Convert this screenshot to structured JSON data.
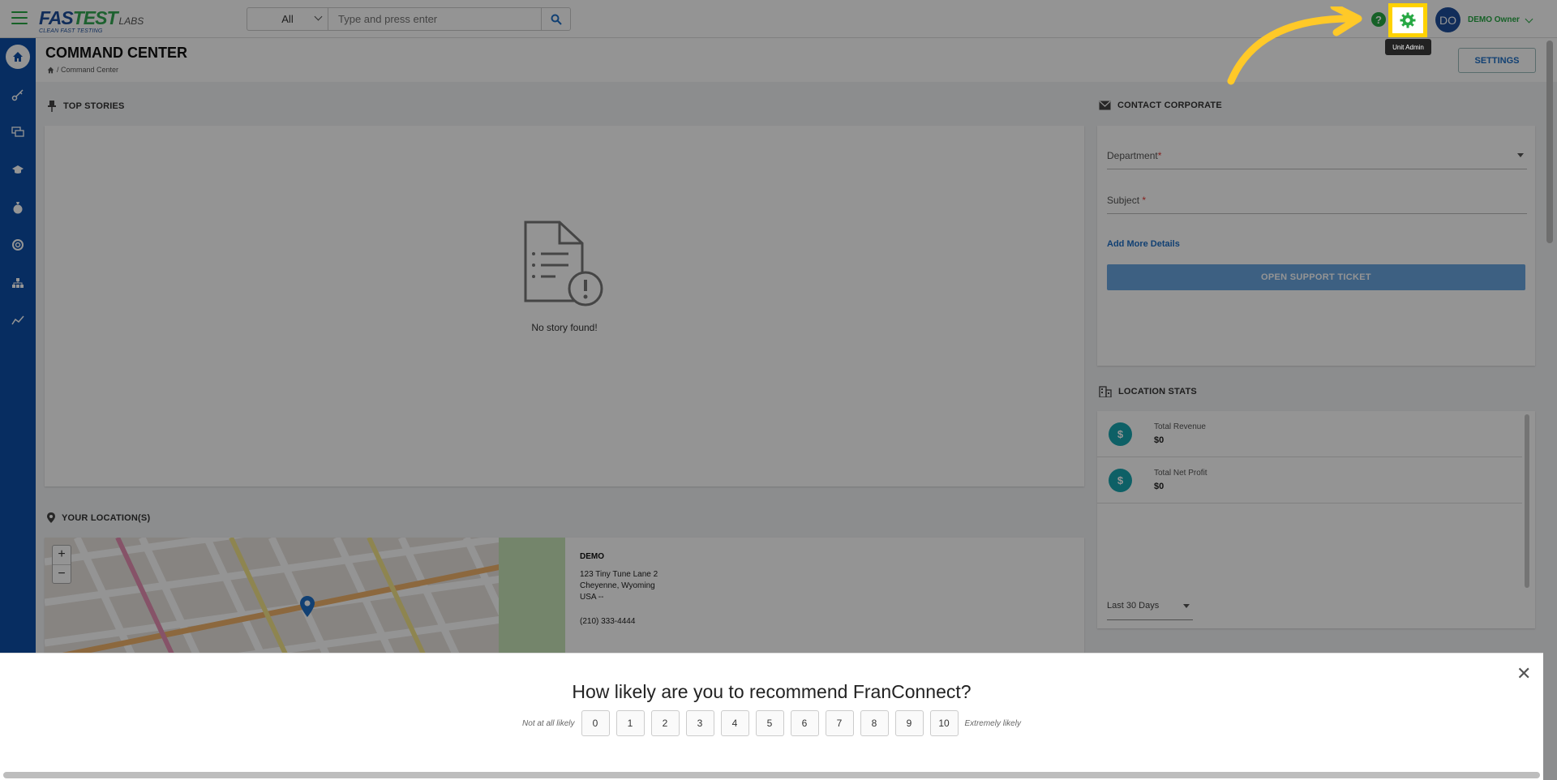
{
  "app": {
    "brand_main": "FASTEST",
    "brand_sub": "LABS",
    "tagline": "CLEAN FAST TESTING"
  },
  "search": {
    "scope": "All",
    "placeholder": "Type and press enter"
  },
  "header": {
    "tooltip": "Unit Admin",
    "avatar_initials": "DO",
    "user_name": "DEMO Owner"
  },
  "page": {
    "title": "COMMAND CENTER",
    "breadcrumb": "/ Command Center",
    "settings_label": "SETTINGS"
  },
  "nav": {
    "items": [
      "home",
      "key",
      "chat",
      "graduation",
      "money-bag",
      "support",
      "org-chart",
      "analytics"
    ]
  },
  "top_stories": {
    "label": "TOP STORIES",
    "empty": "No story found!"
  },
  "contact": {
    "label": "CONTACT CORPORATE",
    "department": "Department",
    "subject": "Subject",
    "required": "*",
    "add_details": "Add More Details",
    "open_ticket": "OPEN SUPPORT TICKET"
  },
  "stats": {
    "label": "LOCATION STATS",
    "rows": [
      {
        "label": "Total Revenue",
        "value": "$0"
      },
      {
        "label": "Total Net Profit",
        "value": "$0"
      }
    ],
    "period": "Last 30 Days"
  },
  "locations": {
    "label": "YOUR LOCATION(S)",
    "name": "DEMO",
    "line1": "123 Tiny Tune Lane 2",
    "line2": "Cheyenne, Wyoming",
    "line3": "USA --",
    "phone": "(210) 333-4444",
    "zoom_in": "+",
    "zoom_out": "−"
  },
  "survey": {
    "question": "How likely are you to recommend FranConnect?",
    "low_label": "Not at all likely",
    "high_label": "Extremely likely",
    "scores": [
      "0",
      "1",
      "2",
      "3",
      "4",
      "5",
      "6",
      "7",
      "8",
      "9",
      "10"
    ],
    "close": "✕"
  },
  "colors": {
    "accent_green": "#27a844",
    "nav_blue": "#0d4fa8",
    "highlight_yellow": "#ffd200",
    "stat_teal": "#19a6b0"
  }
}
